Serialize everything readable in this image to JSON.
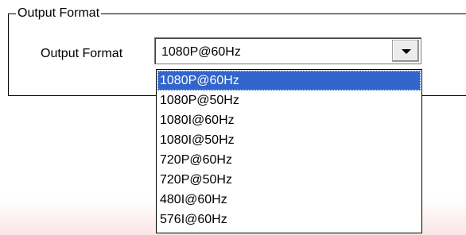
{
  "group": {
    "legend": "Output Format"
  },
  "output_format": {
    "label": "Output Format",
    "selected_value": "1080P@60Hz",
    "options": [
      "1080P@60Hz",
      "1080P@50Hz",
      "1080I@60Hz",
      "1080I@50Hz",
      "720P@60Hz",
      "720P@50Hz",
      "480I@60Hz",
      "576I@60Hz"
    ],
    "highlighted_option": "1080P@60Hz"
  },
  "icons": {
    "dropdown_arrow": "chevron-down-icon"
  },
  "colors": {
    "selection_background": "#3165cc",
    "selection_text": "#ffffff"
  }
}
